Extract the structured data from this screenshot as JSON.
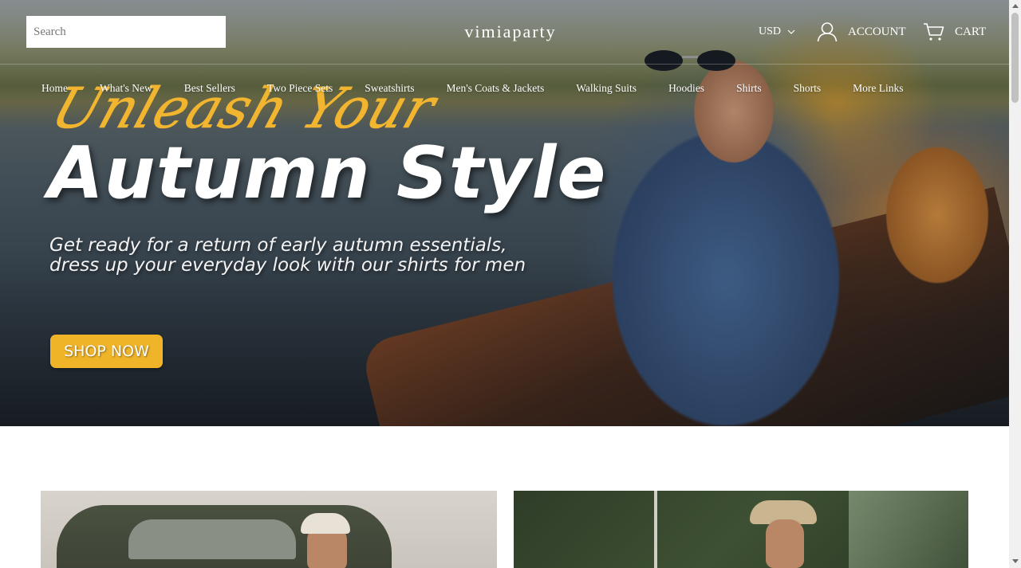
{
  "header": {
    "search_placeholder": "Search",
    "logo": "vimiaparty",
    "currency": "USD",
    "account_label": "ACCOUNT",
    "cart_label": "CART"
  },
  "nav": {
    "items": [
      {
        "label": "Home"
      },
      {
        "label": "What's New"
      },
      {
        "label": "Best Sellers"
      },
      {
        "label": "Two Piece Sets"
      },
      {
        "label": "Sweatshirts"
      },
      {
        "label": "Men's Coats & Jackets"
      },
      {
        "label": "Walking Suits"
      },
      {
        "label": "Hoodies"
      },
      {
        "label": "Shirts"
      },
      {
        "label": "Shorts"
      },
      {
        "label": "More Links"
      }
    ]
  },
  "hero": {
    "script_title": "Unleash Your",
    "headline": "Autumn Style",
    "subcopy_line1": "Get ready for a return of early autumn essentials,",
    "subcopy_line2": "dress up your everyday look with our shirts for men",
    "cta_label": "SHOP NOW"
  },
  "icons": {
    "chevron": "chevron-down-icon",
    "account": "user-icon",
    "cart": "cart-icon"
  },
  "colors": {
    "accent_gold": "#f0b429",
    "script_gold": "#f2b530",
    "text_white": "#ffffff"
  }
}
